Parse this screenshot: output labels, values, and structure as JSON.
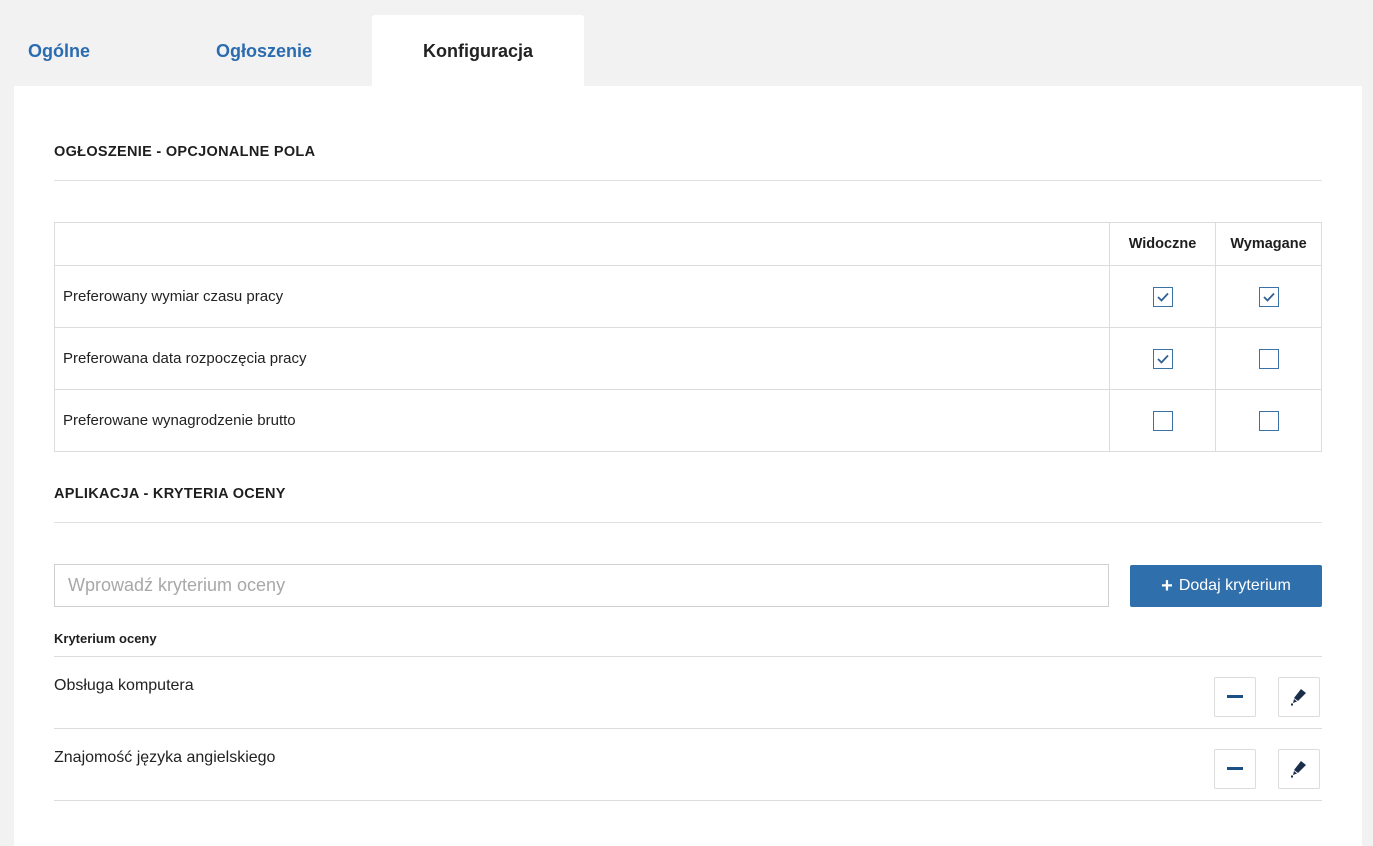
{
  "tabs": [
    {
      "label": "Ogólne",
      "active": false
    },
    {
      "label": "Ogłoszenie",
      "active": false
    },
    {
      "label": "Konfiguracja",
      "active": true
    }
  ],
  "optional_fields": {
    "title": "OGŁOSZENIE - OPCJONALNE POLA",
    "columns": [
      "Widoczne",
      "Wymagane"
    ],
    "rows": [
      {
        "label": "Preferowany wymiar czasu pracy",
        "visible": true,
        "required": true
      },
      {
        "label": "Preferowana data rozpoczęcia pracy",
        "visible": true,
        "required": false
      },
      {
        "label": "Preferowane wynagrodzenie brutto",
        "visible": false,
        "required": false
      }
    ]
  },
  "criteria": {
    "title": "APLIKACJA - KRYTERIA OCENY",
    "input_placeholder": "Wprowadź kryterium oceny",
    "input_value": "",
    "add_button_label": "Dodaj kryterium",
    "list_header": "Kryterium oceny",
    "items": [
      {
        "label": "Obsługa komputera"
      },
      {
        "label": "Znajomość języka angielskiego"
      }
    ]
  },
  "colors": {
    "accent": "#2f6fab",
    "tab_link": "#2b6cb0",
    "checkbox_border": "#3a72a8"
  },
  "icons": {
    "check": "check-icon",
    "plus": "plus-icon",
    "minus": "minus-icon",
    "edit": "pencil-icon"
  }
}
